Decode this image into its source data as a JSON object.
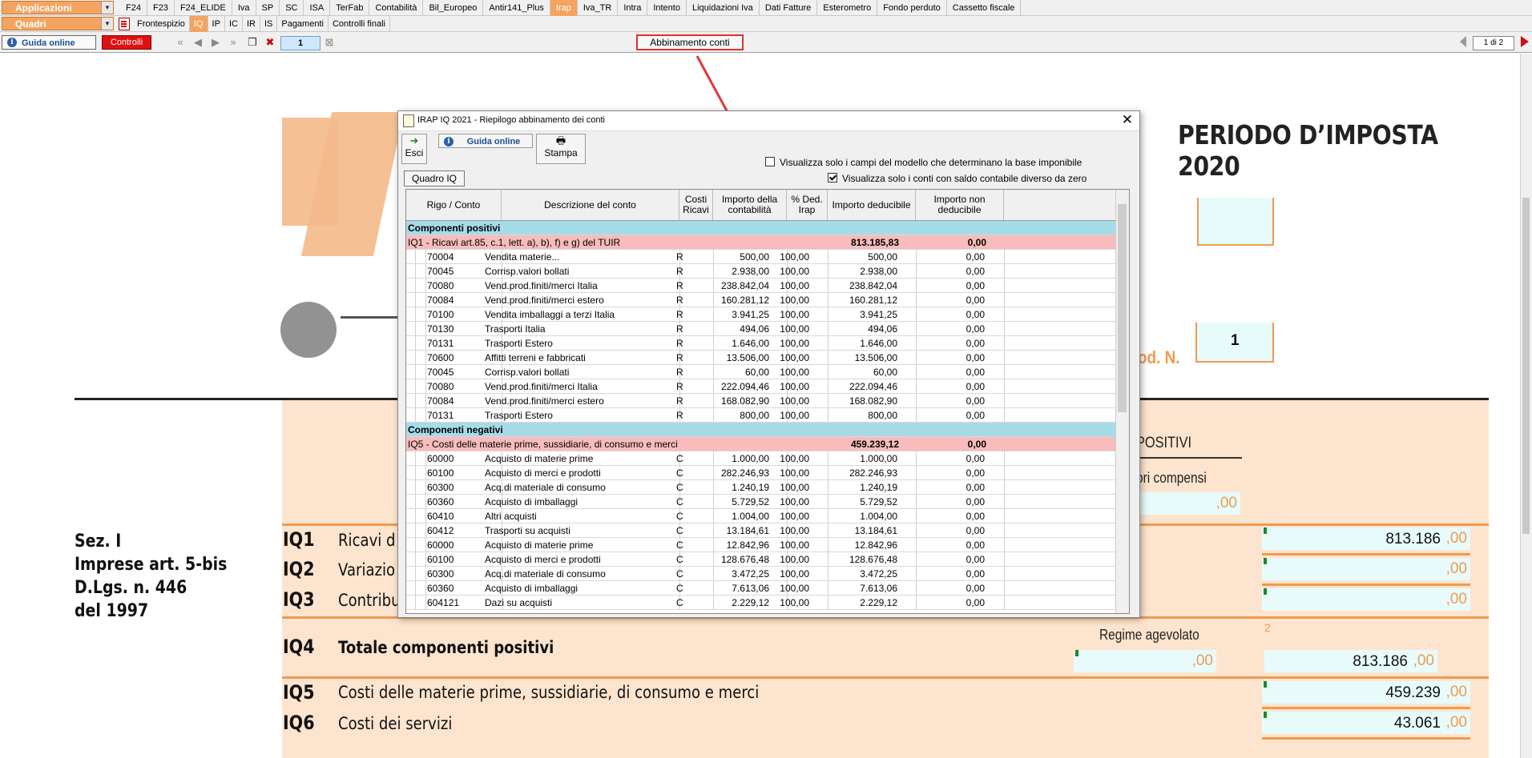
{
  "menu": {
    "app_selector": "Applicazioni",
    "tabs": [
      "F24",
      "F23",
      "F24_ELIDE",
      "Iva",
      "SP",
      "SC",
      "ISA",
      "TerFab",
      "Contabilità",
      "Bil_Europeo",
      "Antir141_Plus",
      "Irap",
      "Iva_TR",
      "Intra",
      "Intento",
      "Liquidazioni Iva",
      "Dati Fatture",
      "Esterometro",
      "Fondo perduto",
      "Cassetto fiscale"
    ],
    "active_tab": "Irap",
    "quadri_selector": "Quadri",
    "quadri_tabs": [
      "Frontespizio",
      "IQ",
      "IP",
      "IC",
      "IR",
      "IS",
      "Pagamenti",
      "Controlli finali"
    ],
    "active_quadro": "IQ"
  },
  "toolbar": {
    "guida_label": "Guida online",
    "controlli_label": "Controlli",
    "page_input": "1",
    "abbinamento_label": "Abbinamento conti",
    "page_count": "1 di 2"
  },
  "form": {
    "periodo": "PERIODO D’IMPOSTA 2020",
    "mod_label": "od. N.",
    "mod_value": "1",
    "positivi_label": "POSITIVI",
    "compensi_label": "ori compensi",
    "sez_title": [
      "Sez. I",
      "Imprese art. 5-bis",
      "D.Lgs. n. 446",
      "del 1997"
    ],
    "regime_label": "Regime agevolato",
    "regime_num": "2",
    "zero_dec": ",00",
    "rows": [
      {
        "code": "IQ1",
        "desc": "Ricavi d",
        "value": "813.186"
      },
      {
        "code": "IQ2",
        "desc": "Variazio",
        "value": ""
      },
      {
        "code": "IQ3",
        "desc": "Contribu",
        "value": ""
      },
      {
        "code": "IQ4",
        "desc": "Totale componenti positivi",
        "value": "813.186"
      },
      {
        "code": "IQ5",
        "desc": "Costi delle materie prime, sussidiarie, di consumo e merci",
        "value": "459.239"
      },
      {
        "code": "IQ6",
        "desc": "Costi dei servizi",
        "value": "43.061"
      }
    ]
  },
  "dialog": {
    "title": "IRAP IQ 2021 - Riepilogo abbinamento dei conti",
    "esci_label": "Esci",
    "guida_label": "Guida online",
    "stampa_label": "Stampa",
    "check1": "Visualizza solo i campi del modello che determinano la base imponibile",
    "check1_on": false,
    "check2": "Visualizza solo i conti con saldo contabile diverso da zero",
    "check2_on": true,
    "quadro_tab": "Quadro IQ",
    "columns": [
      "Rigo / Conto",
      "Descrizione del conto",
      "Costi Ricavi",
      "Importo della contabilità",
      "% Ded. Irap",
      "Importo deducibile",
      "Importo non deducibile"
    ],
    "rows": [
      {
        "type": "sect",
        "label": "Componenti positivi"
      },
      {
        "type": "iq",
        "label": "IQ1 - Ricavi art.85, c.1, lett. a), b), f) e g) del TUIR",
        "ded": "813.185,83",
        "nonded": "0,00"
      },
      {
        "type": "acc",
        "conto": "70004",
        "desc": "Vendita materie...",
        "cr": "R",
        "imp": "500,00",
        "perc": "100,00",
        "ded": "500,00",
        "nonded": "0,00"
      },
      {
        "type": "acc",
        "conto": "70045",
        "desc": "Corrisp.valori bollati",
        "cr": "R",
        "imp": "2.938,00",
        "perc": "100,00",
        "ded": "2.938,00",
        "nonded": "0,00"
      },
      {
        "type": "acc",
        "conto": "70080",
        "desc": "Vend.prod.finiti/merci Italia",
        "cr": "R",
        "imp": "238.842,04",
        "perc": "100,00",
        "ded": "238.842,04",
        "nonded": "0,00"
      },
      {
        "type": "acc",
        "conto": "70084",
        "desc": "Vend.prod.finiti/merci estero",
        "cr": "R",
        "imp": "160.281,12",
        "perc": "100,00",
        "ded": "160.281,12",
        "nonded": "0,00"
      },
      {
        "type": "acc",
        "conto": "70100",
        "desc": "Vendita imballaggi a terzi Italia",
        "cr": "R",
        "imp": "3.941,25",
        "perc": "100,00",
        "ded": "3.941,25",
        "nonded": "0,00"
      },
      {
        "type": "acc",
        "conto": "70130",
        "desc": "Trasporti Italia",
        "cr": "R",
        "imp": "494,06",
        "perc": "100,00",
        "ded": "494,06",
        "nonded": "0,00"
      },
      {
        "type": "acc",
        "conto": "70131",
        "desc": "Trasporti Estero",
        "cr": "R",
        "imp": "1.646,00",
        "perc": "100,00",
        "ded": "1.646,00",
        "nonded": "0,00"
      },
      {
        "type": "acc",
        "conto": "70600",
        "desc": "Affitti terreni e fabbricati",
        "cr": "R",
        "imp": "13.506,00",
        "perc": "100,00",
        "ded": "13.506,00",
        "nonded": "0,00"
      },
      {
        "type": "acc",
        "conto": "70045",
        "desc": "Corrisp.valori bollati",
        "cr": "R",
        "imp": "60,00",
        "perc": "100,00",
        "ded": "60,00",
        "nonded": "0,00"
      },
      {
        "type": "acc",
        "conto": "70080",
        "desc": "Vend.prod.finiti/merci Italia",
        "cr": "R",
        "imp": "222.094,46",
        "perc": "100,00",
        "ded": "222.094,46",
        "nonded": "0,00"
      },
      {
        "type": "acc",
        "conto": "70084",
        "desc": "Vend.prod.finiti/merci estero",
        "cr": "R",
        "imp": "168.082,90",
        "perc": "100,00",
        "ded": "168.082,90",
        "nonded": "0,00"
      },
      {
        "type": "acc",
        "conto": "70131",
        "desc": "Trasporti Estero",
        "cr": "R",
        "imp": "800,00",
        "perc": "100,00",
        "ded": "800,00",
        "nonded": "0,00"
      },
      {
        "type": "sect",
        "label": "Componenti negativi"
      },
      {
        "type": "iq",
        "label": "IQ5 - Costi delle materie prime, sussidiarie, di consumo e merci",
        "ded": "459.239,12",
        "nonded": "0,00"
      },
      {
        "type": "acc",
        "conto": "60000",
        "desc": "Acquisto di materie prime",
        "cr": "C",
        "imp": "1.000,00",
        "perc": "100,00",
        "ded": "1.000,00",
        "nonded": "0,00"
      },
      {
        "type": "acc",
        "conto": "60100",
        "desc": "Acquisto di merci e prodotti",
        "cr": "C",
        "imp": "282.246,93",
        "perc": "100,00",
        "ded": "282.246,93",
        "nonded": "0,00"
      },
      {
        "type": "acc",
        "conto": "60300",
        "desc": "Acq.di materiale di consumo",
        "cr": "C",
        "imp": "1.240,19",
        "perc": "100,00",
        "ded": "1.240,19",
        "nonded": "0,00"
      },
      {
        "type": "acc",
        "conto": "60360",
        "desc": "Acquisto di imballaggi",
        "cr": "C",
        "imp": "5.729,52",
        "perc": "100,00",
        "ded": "5.729,52",
        "nonded": "0,00"
      },
      {
        "type": "acc",
        "conto": "60410",
        "desc": "Altri acquisti",
        "cr": "C",
        "imp": "1.004,00",
        "perc": "100,00",
        "ded": "1.004,00",
        "nonded": "0,00"
      },
      {
        "type": "acc",
        "conto": "60412",
        "desc": "Trasporti su acquisti",
        "cr": "C",
        "imp": "13.184,61",
        "perc": "100,00",
        "ded": "13.184,61",
        "nonded": "0,00"
      },
      {
        "type": "acc",
        "conto": "60000",
        "desc": "Acquisto di materie prime",
        "cr": "C",
        "imp": "12.842,96",
        "perc": "100,00",
        "ded": "12.842,96",
        "nonded": "0,00"
      },
      {
        "type": "acc",
        "conto": "60100",
        "desc": "Acquisto di merci e prodotti",
        "cr": "C",
        "imp": "128.676,48",
        "perc": "100,00",
        "ded": "128.676,48",
        "nonded": "0,00"
      },
      {
        "type": "acc",
        "conto": "60300",
        "desc": "Acq.di materiale di consumo",
        "cr": "C",
        "imp": "3.472,25",
        "perc": "100,00",
        "ded": "3.472,25",
        "nonded": "0,00"
      },
      {
        "type": "acc",
        "conto": "60360",
        "desc": "Acquisto di imballaggi",
        "cr": "C",
        "imp": "7.613,06",
        "perc": "100,00",
        "ded": "7.613,06",
        "nonded": "0,00"
      },
      {
        "type": "acc",
        "conto": "604121",
        "desc": "Dazi su acquisti",
        "cr": "C",
        "imp": "2.229,12",
        "perc": "100,00",
        "ded": "2.229,12",
        "nonded": "0,00"
      }
    ]
  }
}
